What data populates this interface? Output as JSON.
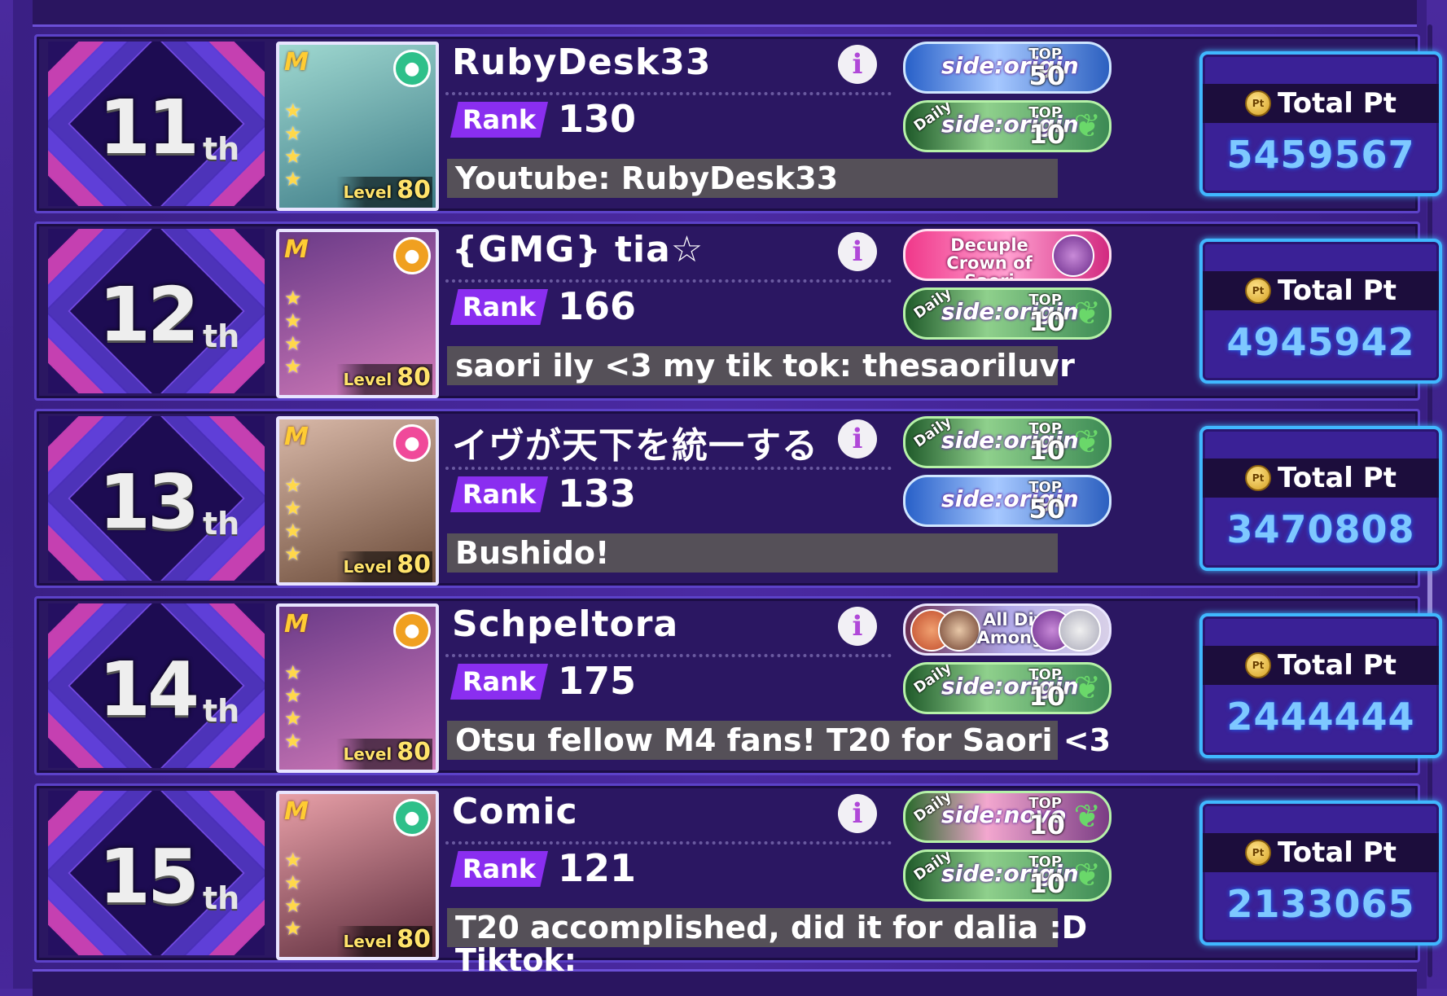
{
  "entries": [
    {
      "rank_num": "11",
      "rank_suffix": "th",
      "name": "RubyDesk33",
      "rank_label": "Rank",
      "player_rank": "130",
      "comment": "Youtube: RubyDesk33",
      "comment2": "",
      "level_label": "Level",
      "level": "80",
      "pts_label": "Total Pt",
      "pts": "5459567",
      "card_colors": [
        "#9fd8d0",
        "#3c7a86"
      ],
      "attr_icon": "leaf-icon",
      "attr_color": "#2ec08a",
      "awards": [
        {
          "type": "origin-top50",
          "daily": "",
          "logo": "side:origin",
          "top": "TOP",
          "num": "50"
        },
        {
          "type": "origin-daily",
          "daily": "Daily",
          "logo": "side:origin",
          "top": "TOP",
          "num": "10"
        }
      ]
    },
    {
      "rank_num": "12",
      "rank_suffix": "th",
      "name": "{GMG} tia☆",
      "rank_label": "Rank",
      "player_rank": "166",
      "comment": "saori ily <3 my tik tok: thesaoriluvr",
      "comment2": "",
      "level_label": "Level",
      "level": "80",
      "pts_label": "Total Pt",
      "pts": "4945942",
      "card_colors": [
        "#6a3a88",
        "#d07ab8"
      ],
      "attr_icon": "sun-icon",
      "attr_color": "#f0a020",
      "awards": [
        {
          "type": "title",
          "title": "Decuple Crown of Saori"
        },
        {
          "type": "origin-daily",
          "daily": "Daily",
          "logo": "side:origin",
          "top": "TOP",
          "num": "10"
        }
      ]
    },
    {
      "rank_num": "13",
      "rank_suffix": "th",
      "name": "イヴが天下を統一する",
      "rank_label": "Rank",
      "player_rank": "133",
      "comment": "Bushido!",
      "comment2": "",
      "level_label": "Level",
      "level": "80",
      "pts_label": "Total Pt",
      "pts": "3470808",
      "card_colors": [
        "#d8b8a8",
        "#6a4a38"
      ],
      "attr_icon": "ribbon-icon",
      "attr_color": "#f04a9a",
      "awards": [
        {
          "type": "origin-daily",
          "daily": "Daily",
          "logo": "side:origin",
          "top": "TOP",
          "num": "10"
        },
        {
          "type": "origin-top50",
          "daily": "",
          "logo": "side:origin",
          "top": "TOP",
          "num": "50"
        }
      ]
    },
    {
      "rank_num": "14",
      "rank_suffix": "th",
      "name": "Schpeltora",
      "rank_label": "Rank",
      "player_rank": "175",
      "comment": "Otsu fellow M4 fans! T20 for Saori <3",
      "comment2": "",
      "level_label": "Level",
      "level": "80",
      "pts_label": "Total Pt",
      "pts": "2444444",
      "card_colors": [
        "#6a3a88",
        "#d07ab8"
      ],
      "attr_icon": "sun-icon",
      "attr_color": "#f0a020",
      "awards": [
        {
          "type": "title-divided",
          "title": "All Divided Among Four"
        },
        {
          "type": "origin-daily",
          "daily": "Daily",
          "logo": "side:origin",
          "top": "TOP",
          "num": "10"
        }
      ]
    },
    {
      "rank_num": "15",
      "rank_suffix": "th",
      "name": "Comic",
      "rank_label": "Rank",
      "player_rank": "121",
      "comment": "T20 accomplished, did it for dalia :D",
      "comment2": "Tiktok:",
      "level_label": "Level",
      "level": "80",
      "pts_label": "Total Pt",
      "pts": "2133065",
      "card_colors": [
        "#e8a0a8",
        "#5a2a3a"
      ],
      "attr_icon": "leaf-icon",
      "attr_color": "#2ec08a",
      "awards": [
        {
          "type": "novo-daily",
          "daily": "Daily",
          "logo": "side:novo",
          "top": "TOP",
          "num": "10"
        },
        {
          "type": "origin-daily",
          "daily": "Daily",
          "logo": "side:origin",
          "top": "TOP",
          "num": "10"
        }
      ]
    }
  ],
  "info_glyph": "i",
  "logo_glyph": "M",
  "star_glyph": "★",
  "laurel_glyph": "❦",
  "coin_text": "Pt"
}
